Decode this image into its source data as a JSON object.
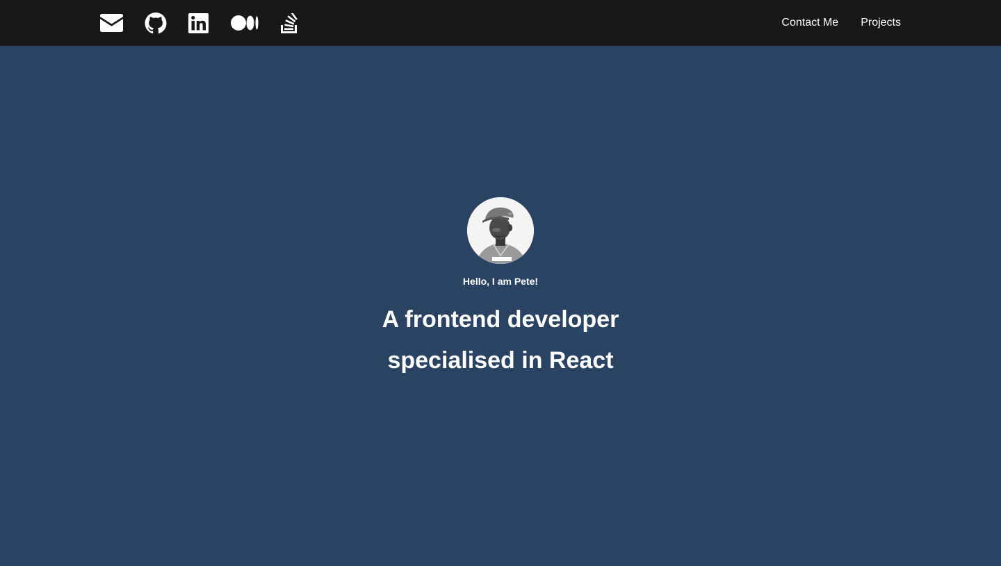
{
  "nav": {
    "social": [
      {
        "icon": "envelope-icon"
      },
      {
        "icon": "github-icon"
      },
      {
        "icon": "linkedin-icon"
      },
      {
        "icon": "medium-icon"
      },
      {
        "icon": "stack-overflow-icon"
      }
    ],
    "links": {
      "contact": "Contact Me",
      "projects": "Projects"
    },
    "background": "#18181b"
  },
  "hero": {
    "avatar_icon": "profile-photo",
    "greeting": "Hello, I am Pete!",
    "headline_line1": "A frontend developer",
    "headline_line2": "specialised in React",
    "background": "#2a4362"
  }
}
